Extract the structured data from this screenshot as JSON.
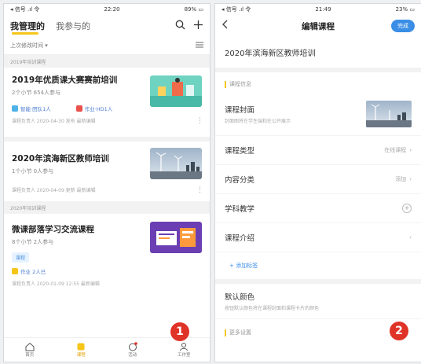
{
  "left": {
    "status": {
      "left": "◂ 信号 .ıl 令",
      "time": "22:20",
      "right": "89% ▭"
    },
    "tabs": [
      "我管理的",
      "我参与的"
    ],
    "sort_label": "上次修改时间 ▾",
    "section1": "2019年培训课程",
    "courses": [
      {
        "title": "2019年优质课大赛赛前培训",
        "meta": "2个小节  654人参与",
        "tag1": "智能·团队1人",
        "tag2": "作业·HD1人",
        "foot": "课程负责人  2020-04-30 发布  最新编辑"
      },
      {
        "title": "2020年滨海新区教师培训",
        "meta": "1个小节  0人参与",
        "foot": "课程负责人  2020-04-09 更新  最新编辑"
      }
    ],
    "section2": "2020年培训课程",
    "course3": {
      "title": "微课部落学习交流课程",
      "meta": "8个小节  2人参与",
      "badge": "课程",
      "task": "作业 2人已",
      "foot": "课程负责人  2020-01-09 12:55 最新编辑"
    },
    "tabbar": [
      {
        "icon": "home-icon",
        "label": "首页"
      },
      {
        "icon": "course-icon",
        "label": "课程"
      },
      {
        "icon": "activity-icon",
        "label": "活动"
      },
      {
        "icon": "me-icon",
        "label": "工作室"
      }
    ],
    "step": "1"
  },
  "right": {
    "status": {
      "left": "◂ 信号 .ıl 令",
      "time": "21:49",
      "right": "23% ▭"
    },
    "title": "编辑课程",
    "save": "完成",
    "course_name": "2020年滨海新区教师培训",
    "section": "课程信息",
    "cover_label": "课程封面",
    "cover_sub": "封面图将在学生端和在公开展示",
    "type_label": "课程类型",
    "type_value": "在线课程",
    "category_label": "内容分类",
    "category_value": "添加",
    "subject_label": "学科教学",
    "intro_label": "课程介绍",
    "add_tag": "+ 添加标签",
    "color_label": "默认颜色",
    "color_sub": "按钮默认颜色将在课程封面和课程卡片的颜色",
    "bottom_section": "更多设置",
    "step": "2"
  },
  "colors": {
    "accent": "#f5c518",
    "blue": "#3a8ee6",
    "red": "#e03328"
  }
}
